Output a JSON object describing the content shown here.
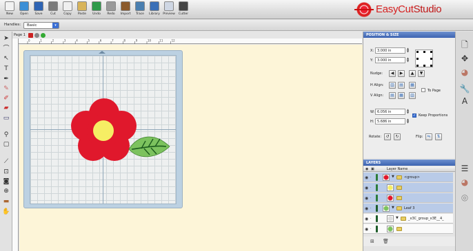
{
  "toolbar": {
    "buttons": [
      {
        "label": "New",
        "icon": "new-document-icon",
        "color": "#f2f2f2"
      },
      {
        "label": "Open",
        "icon": "open-folder-icon",
        "color": "#3c8fd6"
      },
      {
        "label": "Save",
        "icon": "save-disk-icon",
        "color": "#2e64b4"
      },
      {
        "label": "Cut",
        "icon": "scissors-icon",
        "color": "#7a7a7a"
      },
      {
        "label": "Copy",
        "icon": "copy-icon",
        "color": "#efefef"
      },
      {
        "label": "Paste",
        "icon": "paste-clipboard-icon",
        "color": "#d8b45a"
      },
      {
        "label": "Undo",
        "icon": "undo-arrow-icon",
        "color": "#2e9a4a"
      },
      {
        "label": "Redo",
        "icon": "redo-arrow-icon",
        "color": "#9a9a9a"
      },
      {
        "label": "Import",
        "icon": "import-icon",
        "color": "#8b5a2b"
      },
      {
        "label": "Trace",
        "icon": "trace-icon",
        "color": "#4a7fb0"
      },
      {
        "label": "Library",
        "icon": "library-icon",
        "color": "#3a6fb7"
      },
      {
        "label": "Preview",
        "icon": "preview-icon",
        "color": "#cfd7e4"
      },
      {
        "label": "Cutter",
        "icon": "cutter-icon",
        "color": "#444444"
      }
    ],
    "brand": {
      "easy": "EasyCut",
      "studio": "Studio"
    }
  },
  "handles": {
    "label": "Handles:",
    "value": "Basic"
  },
  "document": {
    "tab_label": "Page 1"
  },
  "ruler": {
    "ticks": [
      "0",
      "1",
      "2",
      "3",
      "4",
      "5",
      "6",
      "7",
      "8",
      "9",
      "10",
      "11",
      "12"
    ]
  },
  "position_size": {
    "title": "POSITION & SIZE",
    "x_label": "X:",
    "x_value": "3.000 in",
    "y_label": "Y:",
    "y_value": "3.000 in",
    "nudge_label": "Nudge:",
    "halign_label": "H Align:",
    "valign_label": "V Align:",
    "to_page_label": "To Page",
    "w_label": "W:",
    "w_value": "6.056 in",
    "h_label": "H:",
    "h_value": "5.686 in",
    "keep_proportions_label": "Keep Proportions",
    "rotate_label": "Rotate:",
    "flip_label": "Flip:"
  },
  "layers": {
    "title": "LAYERS",
    "column_label": "Layer Name",
    "rows": [
      {
        "name": "<group>",
        "color": "#2e7d3a",
        "thumb": "flower",
        "selected": true
      },
      {
        "name": "",
        "color": "#2e7d3a",
        "thumb": "yellow-circle",
        "selected": true
      },
      {
        "name": "",
        "color": "#2e7d3a",
        "thumb": "red-flower",
        "selected": true
      },
      {
        "name": "Leaf 3",
        "color": "#1f5d2b",
        "thumb": "leaf",
        "selected": true
      },
      {
        "name": "_x3C_group_x3E__4_",
        "color": "#1f5d2b",
        "thumb": "hatch",
        "selected": false
      },
      {
        "name": "",
        "color": "#1f5d2b",
        "thumb": "leaf",
        "selected": false
      }
    ]
  },
  "colors": {
    "petal": "#e0182c",
    "center": "#f6ee64",
    "leaf": "#7cc25e",
    "leaf_vein": "#1d5c1d"
  }
}
